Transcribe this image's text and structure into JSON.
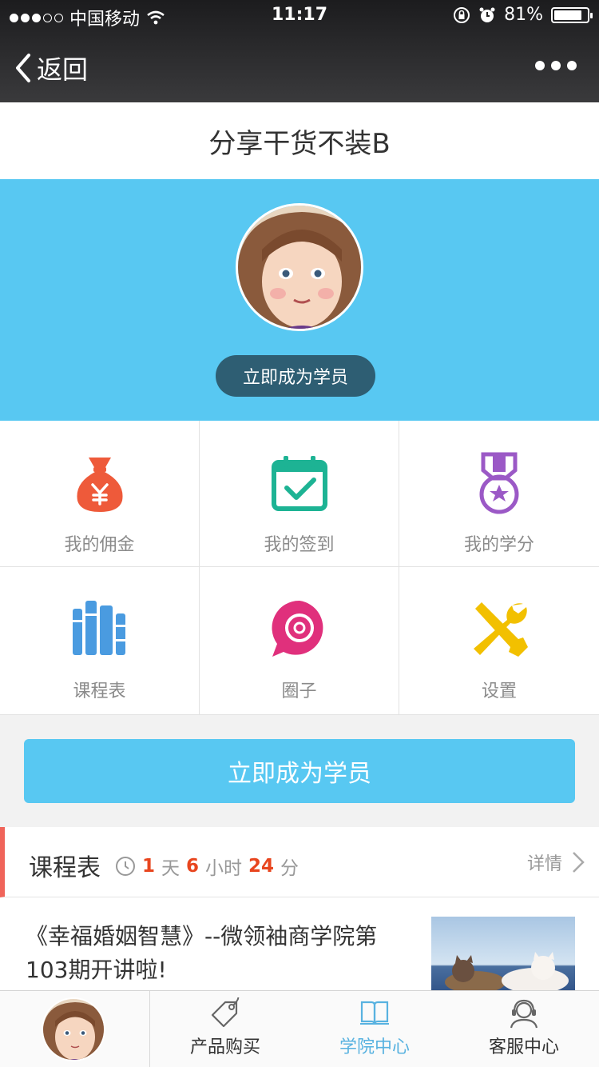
{
  "status_bar": {
    "carrier": "中国移动",
    "time": "11:17",
    "battery": "81%",
    "signal_level": 3
  },
  "nav": {
    "back_label": "返回"
  },
  "page_title": "分享干货不装B",
  "hero": {
    "cta_label": "立即成为学员"
  },
  "grid": [
    {
      "label": "我的佣金",
      "icon": "money-bag-icon",
      "color": "#ee5a3a"
    },
    {
      "label": "我的签到",
      "icon": "calendar-check-icon",
      "color": "#1db394"
    },
    {
      "label": "我的学分",
      "icon": "medal-icon",
      "color": "#9b59c6"
    },
    {
      "label": "课程表",
      "icon": "books-icon",
      "color": "#4a9be0"
    },
    {
      "label": "圈子",
      "icon": "circle-chat-icon",
      "color": "#e0307c"
    },
    {
      "label": "设置",
      "icon": "tools-icon",
      "color": "#f2c000"
    }
  ],
  "main_button": "立即成为学员",
  "schedule": {
    "title": "课程表",
    "days": "1",
    "day_unit": "天",
    "hours": "6",
    "hour_unit": "小时",
    "minutes": "24",
    "minute_unit": "分",
    "detail_label": "详情"
  },
  "article": {
    "title": "《幸福婚姻智慧》--微领袖商学院第103期开讲啦!"
  },
  "tabbar": {
    "items": [
      {
        "label": "产品购买",
        "icon": "tag-icon",
        "active": false
      },
      {
        "label": "学院中心",
        "icon": "book-icon",
        "active": true
      },
      {
        "label": "客服中心",
        "icon": "headset-icon",
        "active": false
      }
    ]
  },
  "colors": {
    "accent": "#58c8f2",
    "hero_button": "#2e5e73",
    "countdown": "#e8451e",
    "schedule_bar": "#f0645a"
  }
}
